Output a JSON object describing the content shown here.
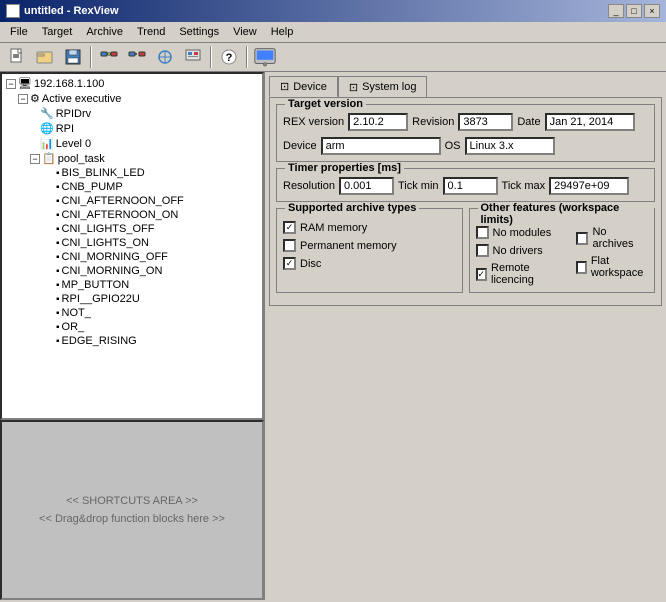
{
  "window": {
    "title": "untitled - RexView",
    "icon": "R"
  },
  "title_buttons": {
    "minimize": "_",
    "maximize": "□",
    "close": "×"
  },
  "menu": {
    "items": [
      "File",
      "Target",
      "Archive",
      "Trend",
      "Settings",
      "View",
      "Help"
    ]
  },
  "toolbar": {
    "buttons": [
      {
        "icon": "📄",
        "name": "new"
      },
      {
        "icon": "📂",
        "name": "open"
      },
      {
        "icon": "💾",
        "name": "save"
      },
      {
        "icon": "🔌",
        "name": "connect1"
      },
      {
        "icon": "🔗",
        "name": "connect2"
      },
      {
        "icon": "⚙",
        "name": "settings1"
      },
      {
        "icon": "⚡",
        "name": "settings2"
      },
      {
        "icon": "❓",
        "name": "help"
      },
      {
        "icon": "🖥",
        "name": "device"
      }
    ]
  },
  "tree": {
    "root": {
      "label": "192.168.1.100",
      "icon": "🖥",
      "children": [
        {
          "label": "Active executive",
          "icon": "⚙",
          "children": [
            {
              "label": "RPIDrv",
              "icon": "🔧"
            },
            {
              "label": "RPI",
              "icon": "🌐"
            },
            {
              "label": "Level 0",
              "icon": "📊"
            },
            {
              "label": "pool_task",
              "icon": "📋",
              "children": [
                "BIS_BLINK_LED",
                "CNB_PUMP",
                "CNI_AFTERNOON_OFF",
                "CNI_AFTERNOON_ON",
                "CNI_LIGHTS_OFF",
                "CNI_LIGHTS_ON",
                "CNI_MORNING_OFF",
                "CNI_MORNING_ON",
                "MP_BUTTON",
                "RPI__GPIO22U",
                "NOT_",
                "OR_",
                "EDGE_RISING"
              ]
            }
          ]
        }
      ]
    }
  },
  "shortcut_area": {
    "line1": "<< SHORTCUTS AREA >>",
    "line2": "<< Drag&drop function blocks here >>"
  },
  "tabs": [
    {
      "label": "Device",
      "icon": "🔲",
      "active": true
    },
    {
      "label": "System log",
      "icon": "🔲",
      "active": false
    }
  ],
  "device_panel": {
    "target_version": {
      "title": "Target version",
      "rex_version_label": "REX version",
      "rex_version_value": "2.10.2",
      "revision_label": "Revision",
      "revision_value": "3873",
      "date_label": "Date",
      "date_value": "Jan 21, 2014",
      "device_label": "Device",
      "device_value": "arm",
      "os_label": "OS",
      "os_value": "Linux 3.x"
    },
    "timer_properties": {
      "title": "Timer properties [ms]",
      "resolution_label": "Resolution",
      "resolution_value": "0.001",
      "tick_min_label": "Tick min",
      "tick_min_value": "0.1",
      "tick_max_label": "Tick max",
      "tick_max_value": "29497e+09"
    },
    "supported_archive_types": {
      "title": "Supported archive types",
      "ram_memory_label": "RAM memory",
      "ram_memory_checked": true,
      "permanent_memory_label": "Permanent memory",
      "permanent_memory_checked": false,
      "disc_label": "Disc",
      "disc_checked": true
    },
    "other_features": {
      "title": "Other features (workspace limits)",
      "no_modules_label": "No modules",
      "no_modules_checked": false,
      "no_drivers_label": "No drivers",
      "no_drivers_checked": false,
      "remote_licencing_label": "Remote licencing",
      "remote_licencing_checked": true,
      "no_archives_label": "No archives",
      "no_archives_checked": false,
      "flat_workspace_label": "Flat workspace",
      "flat_workspace_checked": false
    }
  }
}
